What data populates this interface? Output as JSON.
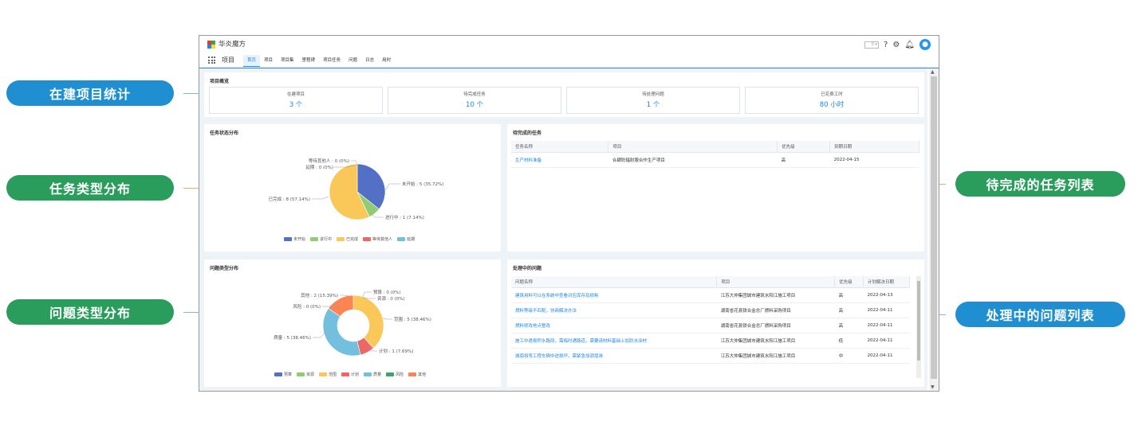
{
  "callouts": {
    "project_stats": "在建项目统计",
    "task_type": "任务类型分布",
    "issue_type": "问题类型分布",
    "pending_tasks": "待完成的任务列表",
    "issues_processing": "处理中的问题列表"
  },
  "app": {
    "brand": "华炎魔方",
    "module": "项目",
    "nav": [
      "首页",
      "项目",
      "项目集",
      "里程碑",
      "项目任务",
      "问题",
      "日志",
      "用时"
    ],
    "active_nav": "首页",
    "tool_select_value": "0",
    "colors": {
      "accent": "#1e88e5",
      "callout_blue": "#1f8fd1",
      "callout_green": "#2a9d5c"
    }
  },
  "overview": {
    "title": "项目概览",
    "stats": [
      {
        "label": "在建项目",
        "value": "3 个"
      },
      {
        "label": "待完成任务",
        "value": "10 个"
      },
      {
        "label": "待处理问题",
        "value": "1 个"
      },
      {
        "label": "已花费工时",
        "value": "80 小时"
      }
    ]
  },
  "task_chart": {
    "title": "任务状态分布",
    "labels": {
      "not_started": "未开始 : 5 (35.72%)",
      "in_progress": "进行中 : 1 (7.14%)",
      "completed": "已完成 : 8 (57.14%)",
      "waiting": "等待其他人 : 0 (0%)",
      "delayed": "延期 : 0 (0%)"
    },
    "legend": [
      "未开始",
      "进行中",
      "已完成",
      "等待其他人",
      "延期"
    ]
  },
  "issue_chart": {
    "title": "问题类型分布",
    "labels": {
      "budget": "预算 : 0 (0%)",
      "resource": "资源 : 0 (0%)",
      "scope": "范围 : 5 (38.46%)",
      "plan": "计划 : 1 (7.69%)",
      "quality": "质量 : 5 (38.46%)",
      "risk": "风险 : 0 (0%)",
      "other": "其他 : 2 (15.39%)"
    },
    "legend": [
      "预算",
      "资源",
      "范围",
      "计划",
      "质量",
      "风险",
      "其他"
    ]
  },
  "chart_data": [
    {
      "type": "pie",
      "title": "任务状态分布",
      "categories": [
        "未开始",
        "进行中",
        "已完成",
        "等待其他人",
        "延期"
      ],
      "values": [
        5,
        1,
        8,
        0,
        0
      ],
      "percent": [
        35.72,
        7.14,
        57.14,
        0,
        0
      ],
      "colors": [
        "#5470c6",
        "#91cc75",
        "#fac858",
        "#ee6666",
        "#73c0de"
      ],
      "legend": "bottom"
    },
    {
      "type": "pie",
      "subtype": "donut",
      "title": "问题类型分布",
      "categories": [
        "预算",
        "资源",
        "范围",
        "计划",
        "质量",
        "风险",
        "其他"
      ],
      "values": [
        0,
        0,
        5,
        1,
        5,
        0,
        2
      ],
      "percent": [
        0,
        0,
        38.46,
        7.69,
        38.46,
        0,
        15.39
      ],
      "colors": [
        "#5470c6",
        "#91cc75",
        "#fac858",
        "#ee6666",
        "#73c0de",
        "#3ba272",
        "#fc8452"
      ],
      "legend": "bottom"
    }
  ],
  "pending_tasks": {
    "title": "待完成的任务",
    "columns": [
      "任务名称",
      "项目",
      "优先级",
      "到期日期"
    ],
    "rows": [
      [
        "生产材料准备",
        "合肆防辐射服合作生产项目",
        "高",
        "2022-04-15"
      ]
    ]
  },
  "issues": {
    "title": "处理中的问题",
    "columns": [
      "问题名称",
      "项目",
      "优先级",
      "计划解决日期"
    ],
    "rows": [
      [
        "建筑用料可以在系统中查看对应库存及损耗",
        "江苏大仲集团城市建筑水阳江施工项目",
        "高",
        "2022-04-13"
      ],
      [
        "燃料等级不匹配，协商解决办法",
        "湖南省花县铁合金总厂燃料采购项目",
        "高",
        "2022-04-11"
      ],
      [
        "燃料修改地点整改",
        "湖南省花县铁合金总厂燃料采购项目",
        "高",
        "2022-04-11"
      ],
      [
        "施工中遇易积水路段，需临时通路道，需要请材料基础上加防水涂材",
        "江苏大仲集团城市建筑水阳江施工项目",
        "低",
        "2022-04-11"
      ],
      [
        "城南拐弯工程车辆中途损坏，需紧急加调增准",
        "江苏大仲集团城市建筑水阳江施工项目",
        "中",
        "2022-04-11"
      ]
    ]
  }
}
